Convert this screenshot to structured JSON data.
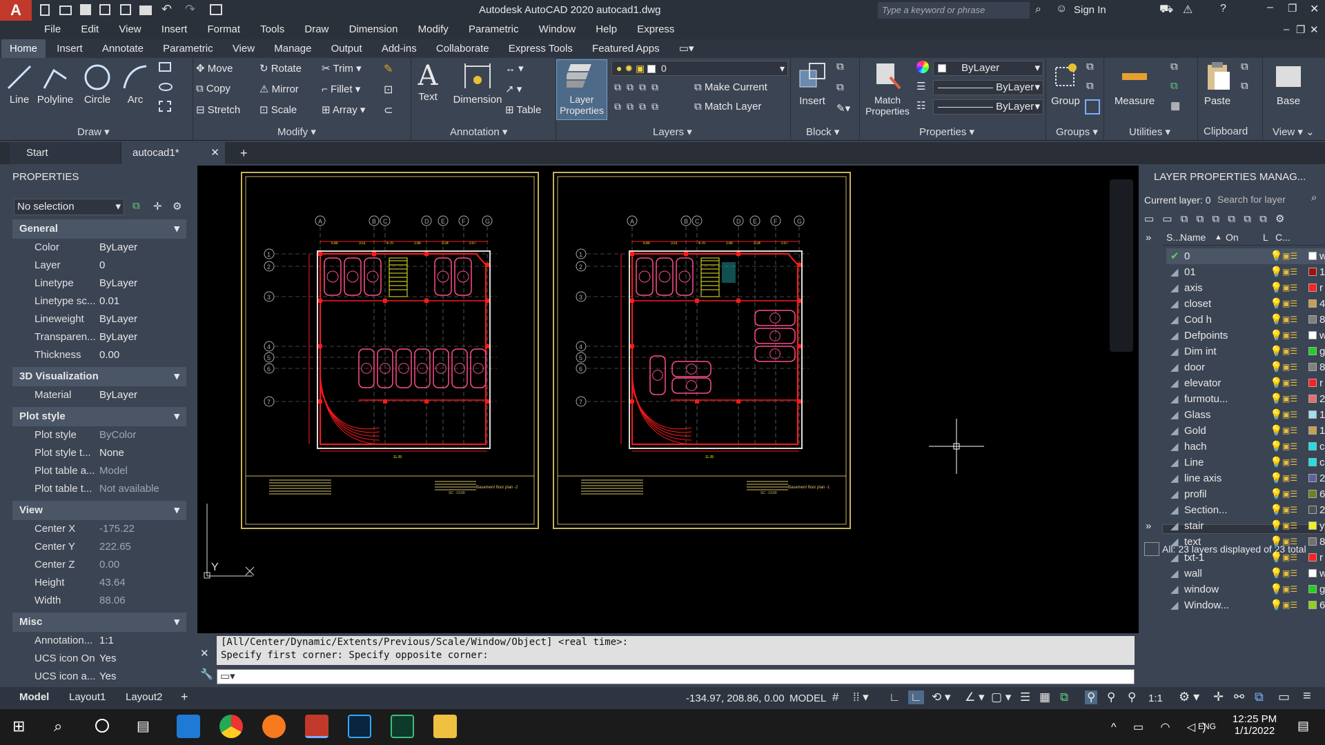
{
  "window": {
    "title": "Autodesk AutoCAD 2020   autocad1.dwg",
    "search_placeholder": "Type a keyword or phrase",
    "sign_in": "Sign In",
    "logo_letter": "A"
  },
  "menu": [
    "File",
    "Edit",
    "View",
    "Insert",
    "Format",
    "Tools",
    "Draw",
    "Dimension",
    "Modify",
    "Parametric",
    "Window",
    "Help",
    "Express"
  ],
  "ribbon_tabs": [
    "Home",
    "Insert",
    "Annotate",
    "Parametric",
    "View",
    "Manage",
    "Output",
    "Add-ins",
    "Collaborate",
    "Express Tools",
    "Featured Apps"
  ],
  "ribbon": {
    "draw": {
      "label": "Draw",
      "line": "Line",
      "polyline": "Polyline",
      "circle": "Circle",
      "arc": "Arc"
    },
    "modify": {
      "label": "Modify",
      "move": "Move",
      "rotate": "Rotate",
      "trim": "Trim",
      "copy": "Copy",
      "mirror": "Mirror",
      "fillet": "Fillet",
      "stretch": "Stretch",
      "scale": "Scale",
      "array": "Array"
    },
    "annotation": {
      "label": "Annotation",
      "text": "Text",
      "dimension": "Dimension",
      "table": "Table"
    },
    "layers": {
      "label": "Layers",
      "layer_properties": "Layer Properties",
      "current_layer": "0",
      "make_current": "Make Current",
      "match_layer": "Match Layer"
    },
    "block": {
      "label": "Block",
      "insert": "Insert"
    },
    "properties": {
      "label": "Properties",
      "match_properties": "Match Properties",
      "color": "ByLayer",
      "lineweight": "ByLayer",
      "linetype": "ByLayer"
    },
    "groups": {
      "label": "Groups",
      "group": "Group"
    },
    "utilities": {
      "label": "Utilities",
      "measure": "Measure"
    },
    "clipboard": {
      "label": "Clipboard",
      "paste": "Paste"
    },
    "view": {
      "label": "View",
      "base": "Base"
    }
  },
  "doc_tabs": {
    "start": "Start",
    "active": "autocad1*",
    "close": "✕",
    "new": "+"
  },
  "properties_panel": {
    "title": "PROPERTIES",
    "selection": "No selection",
    "sections": {
      "general": {
        "title": "General",
        "rows": [
          {
            "k": "Color",
            "v": "ByLayer"
          },
          {
            "k": "Layer",
            "v": "0"
          },
          {
            "k": "Linetype",
            "v": "ByLayer"
          },
          {
            "k": "Linetype sc...",
            "v": "0.01"
          },
          {
            "k": "Lineweight",
            "v": "ByLayer"
          },
          {
            "k": "Transparen...",
            "v": "ByLayer"
          },
          {
            "k": "Thickness",
            "v": "0.00"
          }
        ]
      },
      "viz": {
        "title": "3D Visualization",
        "rows": [
          {
            "k": "Material",
            "v": "ByLayer"
          }
        ]
      },
      "plot": {
        "title": "Plot style",
        "rows": [
          {
            "k": "Plot style",
            "v": "ByColor"
          },
          {
            "k": "Plot style t...",
            "v": "None"
          },
          {
            "k": "Plot table a...",
            "v": "Model"
          },
          {
            "k": "Plot table t...",
            "v": "Not available"
          }
        ]
      },
      "view": {
        "title": "View",
        "rows": [
          {
            "k": "Center X",
            "v": "-175.22"
          },
          {
            "k": "Center Y",
            "v": "222.65"
          },
          {
            "k": "Center Z",
            "v": "0.00"
          },
          {
            "k": "Height",
            "v": "43.64"
          },
          {
            "k": "Width",
            "v": "88.06"
          }
        ]
      },
      "misc": {
        "title": "Misc",
        "rows": [
          {
            "k": "Annotation...",
            "v": "1:1"
          },
          {
            "k": "UCS icon On",
            "v": "Yes"
          },
          {
            "k": "UCS icon a...",
            "v": "Yes"
          }
        ]
      }
    }
  },
  "command": {
    "line1": "[All/Center/Dynamic/Extents/Previous/Scale/Window/Object] <real time>:",
    "line2": "Specify first corner: Specify opposite corner:"
  },
  "drawing": {
    "axis_top": [
      "A",
      "B",
      "C",
      "D",
      "E",
      "F",
      "G"
    ],
    "axis_left": [
      "1",
      "2",
      "3",
      "4",
      "5",
      "6",
      "7"
    ],
    "ucs_y": "Y",
    "sheet1_caption": "Basement floor plan -2",
    "sheet2_caption": "Basement floor plan -1",
    "scale_note": "SC : 1/100",
    "dims": [
      "6.86",
      "3.51",
      "4.70",
      "1.86",
      "3.34",
      "2.67",
      "17.86",
      "7.00",
      "7.00",
      "0.50",
      "2.87",
      "5.30",
      "5.10",
      "6.10",
      "19.57",
      "3.40",
      "11.35",
      "31.42",
      "6.40",
      "4.61"
    ]
  },
  "layer_panel": {
    "title": "LAYER PROPERTIES MANAG...",
    "current_layer": "Current layer: 0",
    "search_placeholder": "Search for layer",
    "headers": {
      "status": "S...",
      "name": "Name",
      "on": "On",
      "l": "L",
      "c": "C..."
    },
    "layers": [
      {
        "name": "0",
        "color": "#ffffff",
        "code": "w"
      },
      {
        "name": "01",
        "color": "#a01010",
        "code": "1"
      },
      {
        "name": "axis",
        "color": "#ff2020",
        "code": "r"
      },
      {
        "name": "closet",
        "color": "#c8a050",
        "code": "4"
      },
      {
        "name": "Cod h",
        "color": "#808080",
        "code": "8"
      },
      {
        "name": "Defpoints",
        "color": "#ffffff",
        "code": "w"
      },
      {
        "name": "Dim int",
        "color": "#20d020",
        "code": "g"
      },
      {
        "name": "door",
        "color": "#808080",
        "code": "8"
      },
      {
        "name": "elevator",
        "color": "#ff2020",
        "code": "r"
      },
      {
        "name": "furmotu...",
        "color": "#e07070",
        "code": "2"
      },
      {
        "name": "Glass",
        "color": "#a0e0f0",
        "code": "1"
      },
      {
        "name": "Gold",
        "color": "#c8a050",
        "code": "1"
      },
      {
        "name": "hach",
        "color": "#20e0e0",
        "code": "c"
      },
      {
        "name": "Line",
        "color": "#20e0e0",
        "code": "c"
      },
      {
        "name": "line axis",
        "color": "#6060a0",
        "code": "2"
      },
      {
        "name": "profil",
        "color": "#708020",
        "code": "6"
      },
      {
        "name": "Section...",
        "color": "#505050",
        "code": "2"
      },
      {
        "name": "stair",
        "color": "#f0f020",
        "code": "y"
      },
      {
        "name": "text",
        "color": "#707070",
        "code": "8"
      },
      {
        "name": "txt-1",
        "color": "#ff2020",
        "code": "r"
      },
      {
        "name": "wall",
        "color": "#ffffff",
        "code": "w"
      },
      {
        "name": "window",
        "color": "#20d020",
        "code": "g"
      },
      {
        "name": "Window...",
        "color": "#90d020",
        "code": "6"
      }
    ],
    "footer": "All: 23 layers displayed of 23 total"
  },
  "status": {
    "layout_tabs": [
      "Model",
      "Layout1",
      "Layout2"
    ],
    "coords": "-134.97, 208.86, 0.00",
    "mode": "MODEL",
    "scale": "1:1"
  },
  "taskbar": {
    "time": "12:25 PM",
    "date": "1/1/2022",
    "lang": "ENG"
  },
  "colors": {
    "accent": "#c0392b",
    "panel": "#3b4453",
    "wall_red": "#ff1a1a",
    "car_pink": "#ff4f8a",
    "sheet_gold": "#c9b25a"
  }
}
